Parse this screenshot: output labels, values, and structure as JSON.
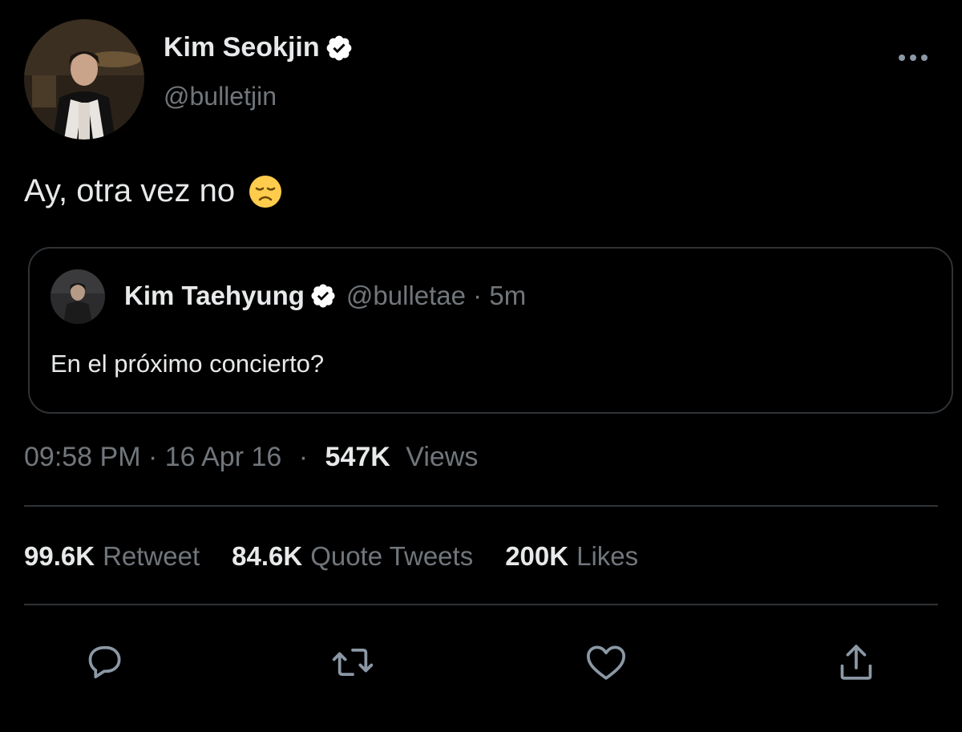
{
  "tweet": {
    "author_name": "Kim Seokjin",
    "author_handle": "@bulletjin",
    "text": "Ay, otra vez no",
    "emoji": "disappointed-face",
    "timestamp": "09:58 PM · 16 Apr 16",
    "separator": "·",
    "views_count": "547K",
    "views_label": "Views"
  },
  "quote": {
    "name": "Kim Taehyung",
    "meta": "@bulletae · 5m",
    "text": "En el próximo concierto?"
  },
  "stats": [
    {
      "count": "99.6K",
      "label": "Retweet"
    },
    {
      "count": "84.6K",
      "label": "Quote Tweets"
    },
    {
      "count": "200K",
      "label": "Likes"
    }
  ],
  "actions": [
    "reply-icon",
    "retweet-icon",
    "like-icon",
    "share-icon"
  ],
  "colors": {
    "background": "#000000",
    "primary_text": "#e7e9ea",
    "secondary_text": "#71767b",
    "border": "#2f3336",
    "verified_badge": "#ffffff",
    "action_icon": "#8b98a5"
  }
}
